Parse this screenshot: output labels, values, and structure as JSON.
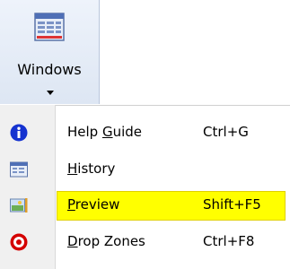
{
  "ribbon": {
    "windows_label": "Windows",
    "icon": "windows-icon"
  },
  "menu": {
    "items": [
      {
        "label_pre": "Help ",
        "label_key": "G",
        "label_post": "uide",
        "shortcut": "Ctrl+G",
        "icon": "info-icon"
      },
      {
        "label_pre": "",
        "label_key": "H",
        "label_post": "istory",
        "shortcut": "",
        "icon": "history-icon"
      },
      {
        "label_pre": "",
        "label_key": "P",
        "label_post": "review",
        "shortcut": "Shift+F5",
        "icon": "preview-icon",
        "highlighted": true
      },
      {
        "label_pre": "",
        "label_key": "D",
        "label_post": "rop Zones",
        "shortcut": "Ctrl+F8",
        "icon": "drop-zones-icon"
      }
    ]
  },
  "colors": {
    "highlight": "#ffff00",
    "info_blue": "#1533d0",
    "target_red": "#d40000"
  }
}
